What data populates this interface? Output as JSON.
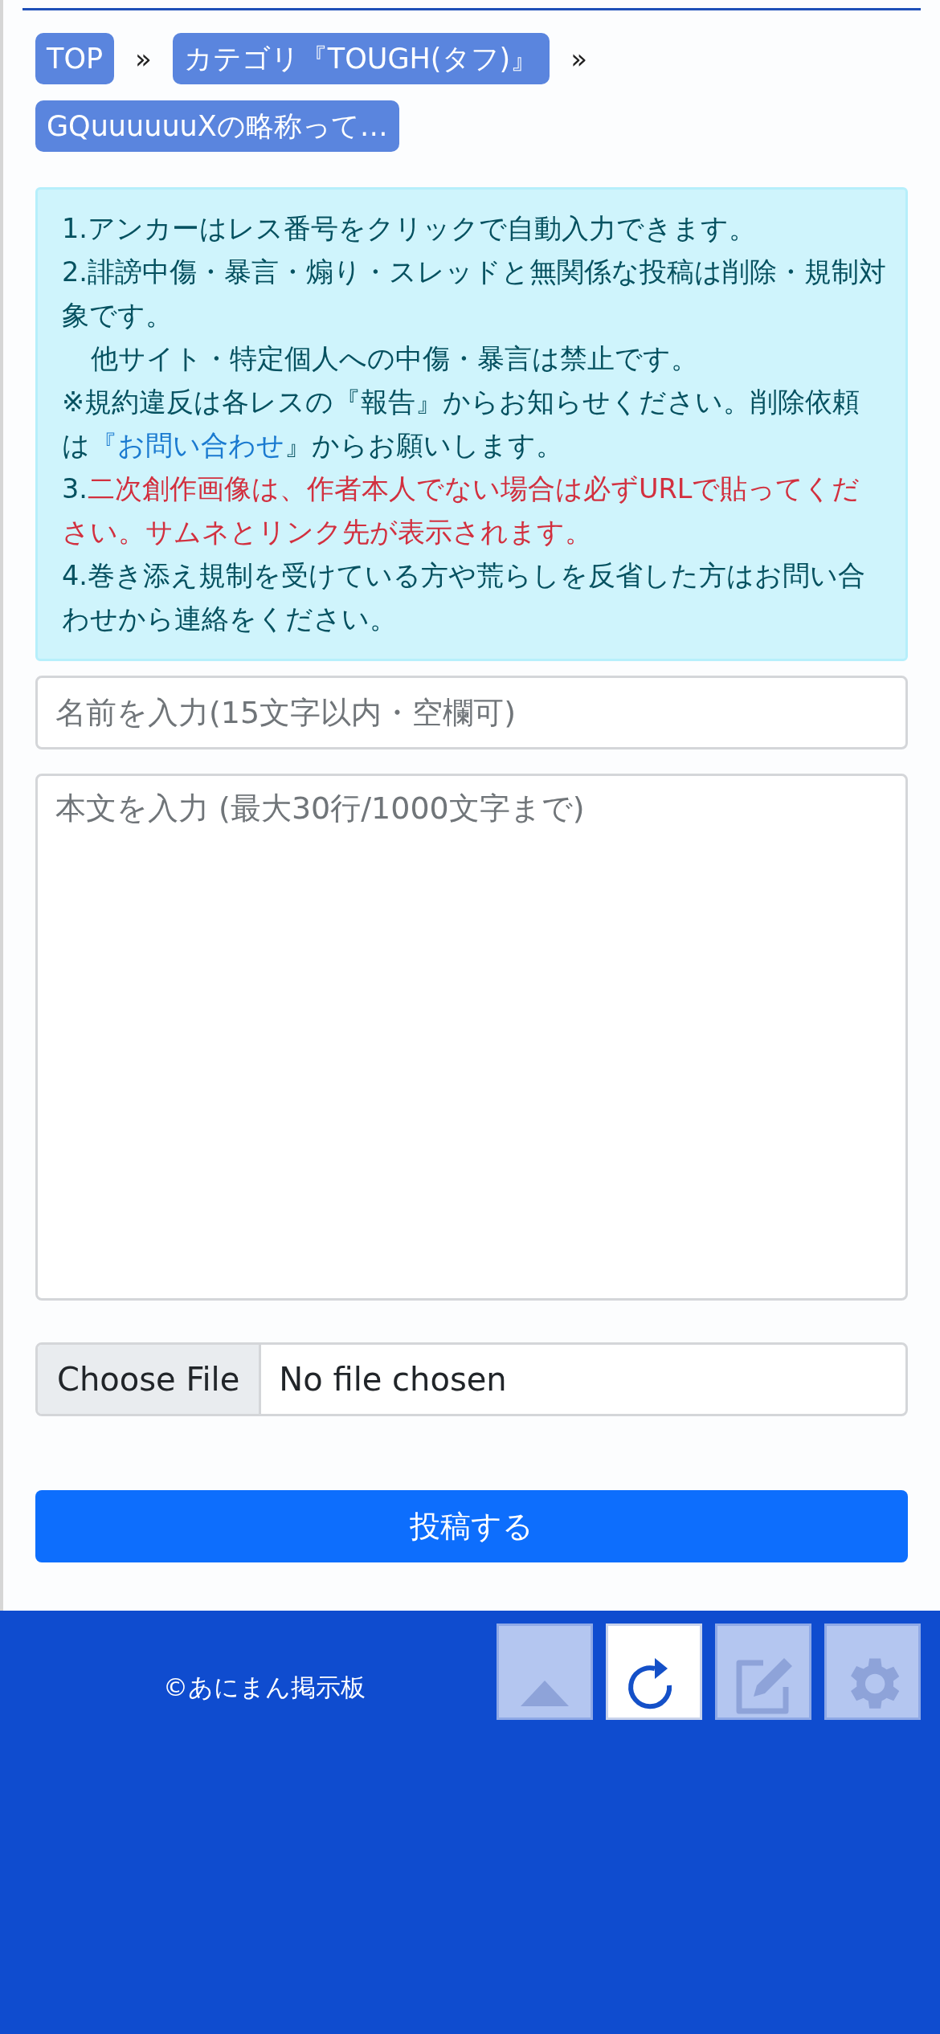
{
  "breadcrumbs": [
    {
      "label": "TOP"
    },
    {
      "label": "カテゴリ『TOUGH(タフ)』"
    },
    {
      "label": "GQuuuuuuXの略称って…"
    }
  ],
  "breadcrumb_separator": "»",
  "notice": [
    {
      "kind": "normal",
      "text": "1.アンカーはレス番号をクリックで自動入力できます。"
    },
    {
      "kind": "normal",
      "text": "2.誹謗中傷・暴言・煽り・スレッドと無関係な投稿は削除・規制対象です。"
    },
    {
      "kind": "indent",
      "text": "他サイト・特定個人への中傷・暴言は禁止です。"
    },
    {
      "kind": "link",
      "before": "※規約違反は各レスの『報告』からお知らせください。削除依頼は",
      "link": "『お問い合わせ",
      "after": "』からお願いします。"
    },
    {
      "kind": "warning",
      "prefix": "3.",
      "text": "二次創作画像は、作者本人でない場合は必ずURLで貼ってください。サムネとリンク先が表示されます。"
    },
    {
      "kind": "normal",
      "text": "4.巻き添え規制を受けている方や荒らしを反省した方はお問い合わせから連絡をください。"
    }
  ],
  "name_field": {
    "placeholder": "名前を入力(15文字以内・空欄可)"
  },
  "body_field": {
    "placeholder": "本文を入力 (最大30行/1000文字まで)"
  },
  "file_input": {
    "button": "Choose File",
    "status": "No file chosen"
  },
  "submit_button": "投稿する",
  "footer": {
    "copyright": "©あにまん掲示板"
  },
  "floating_buttons": [
    {
      "kind": "up",
      "disabled": true
    },
    {
      "kind": "reload",
      "disabled": false
    },
    {
      "kind": "edit",
      "disabled": true
    },
    {
      "kind": "settings",
      "disabled": true
    }
  ]
}
